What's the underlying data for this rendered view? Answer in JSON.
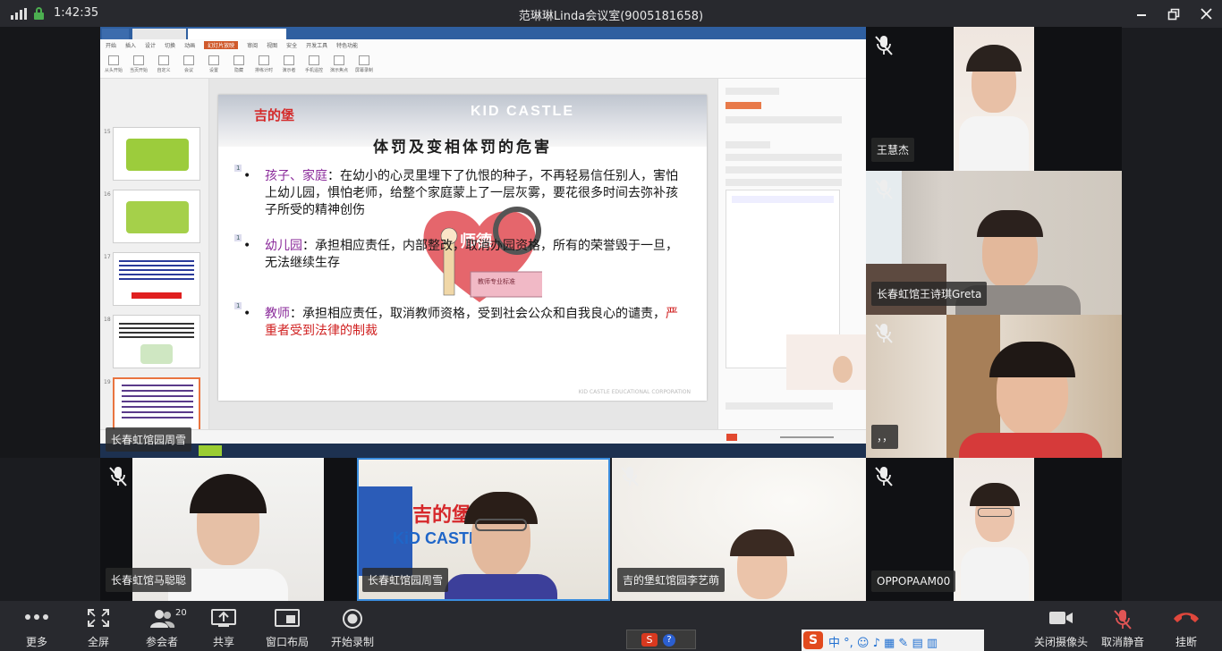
{
  "status": {
    "time": "1:42:35"
  },
  "window": {
    "title": "范琳琳Linda会议室(9005181658)"
  },
  "colors": {
    "accent": "#3a8dde",
    "hangup": "#e0473c",
    "mic_muted": "#e05555"
  },
  "slide": {
    "logo_text": "吉的堡",
    "brand_text": "KID CASTLE",
    "title": "体罚及变相体罚的危害",
    "heart_label": "师德",
    "board_label": "教师专业标准",
    "footer": "KID CASTLE EDUCATIONAL CORPORATION",
    "points": [
      {
        "num": "1",
        "term": "孩子、家庭",
        "text": "：在幼小的心灵里埋下了仇恨的种子，不再轻易信任别人，害怕上幼儿园，惧怕老师，给整个家庭蒙上了一层灰雾，要花很多时间去弥补孩子所受的精神创伤",
        "red": ""
      },
      {
        "num": "1",
        "term": "幼儿园",
        "text": "：承担相应责任，内部整改，取消办园资格，所有的荣誉毁于一旦，无法继续生存",
        "red": ""
      },
      {
        "num": "1",
        "term": "教师",
        "text": "：承担相应责任，取消教师资格，受到社会公众和自我良心的谴责，",
        "red": "严重者受到法律的制裁"
      }
    ]
  },
  "participants": {
    "sharer": "长春虹馆园周雪",
    "p1": "王慧杰",
    "p2": "长春虹馆王诗琪Greta",
    "p3": "，，",
    "p4": "长春虹馆马聪聪",
    "p5": "长春虹馆园周雪",
    "p6": "吉的堡虹馆园李艺萌",
    "p7": "OPPOPAAM00"
  },
  "toolbar": {
    "more": "更多",
    "fullscreen": "全屏",
    "participants": "参会者",
    "participants_count": "20",
    "share": "共享",
    "layout": "窗口布局",
    "record": "开始录制",
    "camera_off": "关闭摄像头",
    "unmute": "取消静音",
    "hangup": "挂断"
  }
}
